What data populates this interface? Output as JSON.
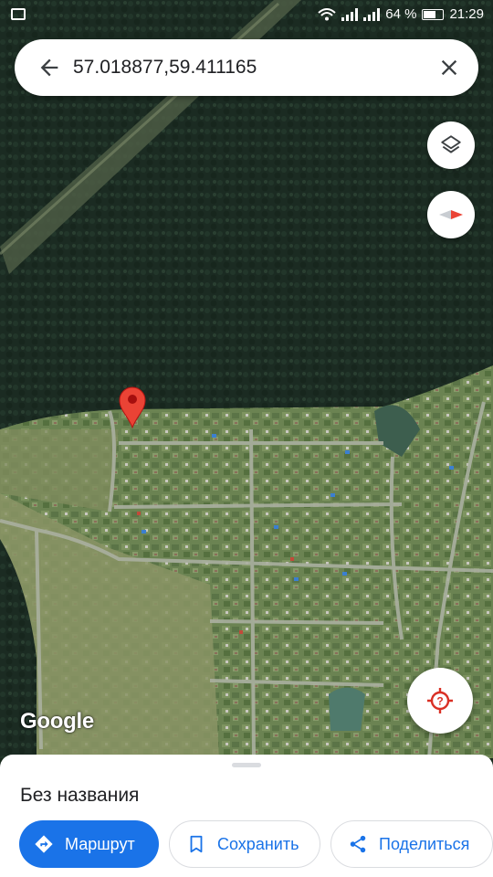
{
  "status_bar": {
    "battery": "64 %",
    "time": "21:29"
  },
  "search": {
    "query": "57.018877,59.411165"
  },
  "map": {
    "attribution": "Google",
    "pin_color": "#ea4335"
  },
  "controls": {
    "layers_icon": "layers-icon",
    "compass_icon": "compass-icon",
    "my_location_icon": "location-crosshair-icon"
  },
  "place_sheet": {
    "title": "Без названия",
    "actions": {
      "directions": "Маршрут",
      "save": "Сохранить",
      "share": "Поделиться"
    }
  },
  "colors": {
    "accent": "#1a73e8",
    "text": "#202124",
    "location_red": "#d93025"
  }
}
